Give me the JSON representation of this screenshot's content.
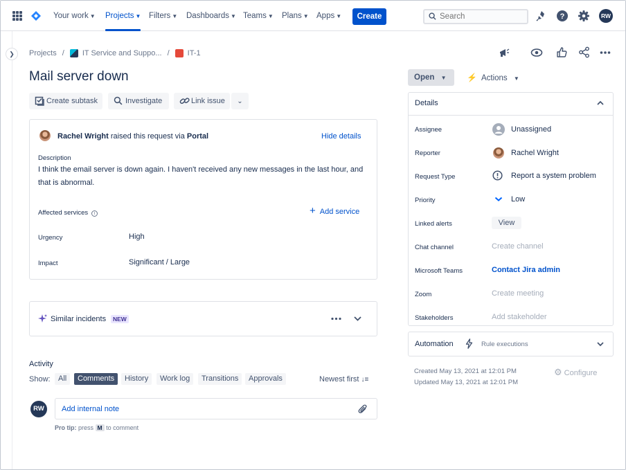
{
  "nav": {
    "items": [
      {
        "label": "Your work",
        "active": false
      },
      {
        "label": "Projects",
        "active": true
      },
      {
        "label": "Filters",
        "active": false
      },
      {
        "label": "Dashboards",
        "active": false
      },
      {
        "label": "Teams",
        "active": false
      },
      {
        "label": "Plans",
        "active": false
      },
      {
        "label": "Apps",
        "active": false
      }
    ],
    "create_label": "Create",
    "search_placeholder": "Search",
    "avatar_initials": "RW"
  },
  "breadcrumb": {
    "projects": "Projects",
    "project": "IT Service and Suppo...",
    "issue_key": "IT-1"
  },
  "issue": {
    "title": "Mail server down",
    "actions": {
      "create_subtask": "Create subtask",
      "investigate": "Investigate",
      "link_issue": "Link issue"
    },
    "request": {
      "reporter_name": "Rachel Wright",
      "raised_text": "raised this request via",
      "channel": "Portal",
      "hide_details": "Hide details",
      "description_label": "Description",
      "description_line1": "I think the email server is down again.  I haven't received any new messages in the last hour, and",
      "description_line2": "that is abnormal.",
      "affected_services_label": "Affected services",
      "add_service": "Add service",
      "urgency_label": "Urgency",
      "urgency_value": "High",
      "impact_label": "Impact",
      "impact_value": "Significant / Large"
    },
    "similar": {
      "label": "Similar incidents",
      "badge": "NEW"
    },
    "activity": {
      "heading": "Activity",
      "show_label": "Show:",
      "filters": [
        "All",
        "Comments",
        "History",
        "Work log",
        "Transitions",
        "Approvals"
      ],
      "active_filter": "Comments",
      "sort": "Newest first",
      "comment_placeholder": "Add internal note",
      "pro_tip_label": "Pro tip:",
      "pro_tip_press": "press",
      "pro_tip_key": "M",
      "pro_tip_rest": "to comment"
    }
  },
  "side": {
    "status": "Open",
    "actions_label": "Actions",
    "details_title": "Details",
    "fields": [
      {
        "label": "Assignee",
        "value": "Unassigned",
        "style": "normal",
        "icon": "unassigned-avatar-icon"
      },
      {
        "label": "Reporter",
        "value": "Rachel Wright",
        "style": "normal",
        "icon": "reporter-avatar"
      },
      {
        "label": "Request Type",
        "value": "Report a system problem",
        "style": "normal",
        "icon": "system-problem-icon"
      },
      {
        "label": "Priority",
        "value": "Low",
        "style": "normal",
        "icon": "priority-low-icon"
      },
      {
        "label": "Linked alerts",
        "value": "View",
        "style": "button"
      },
      {
        "label": "Chat channel",
        "value": "Create channel",
        "style": "muted"
      },
      {
        "label": "Microsoft Teams",
        "value": "Contact Jira admin",
        "style": "link"
      },
      {
        "label": "Zoom",
        "value": "Create meeting",
        "style": "muted"
      },
      {
        "label": "Stakeholders",
        "value": "Add stakeholder",
        "style": "muted"
      }
    ],
    "automation_title": "Automation",
    "rule_executions": "Rule executions",
    "created": "Created May 13, 2021 at 12:01 PM",
    "updated": "Updated May 13, 2021 at 12:01 PM",
    "configure": "Configure"
  },
  "colors": {
    "brand": "#0052cc",
    "text": "#172b4d",
    "muted": "#a5adba",
    "subtle": "#42526e"
  }
}
